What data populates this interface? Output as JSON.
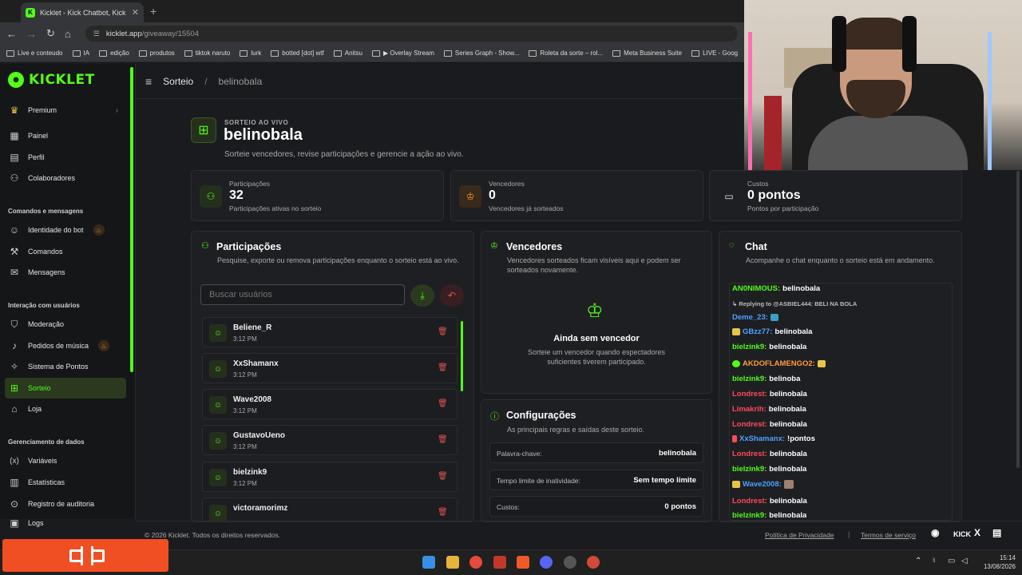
{
  "browser": {
    "tab_title": "Kicklet - Kick Chatbot, Kick Wi...",
    "url_host": "kicklet.app",
    "url_path": "/giveaway/15504",
    "bookmarks": [
      "Live e conteudo",
      "IA",
      "edição",
      "produtos",
      "tiktok naruto",
      "lurk",
      "botted [dot] wtf",
      "Anitsu",
      "▶ Overlay Stream",
      "Series Graph - Show...",
      "Roleta da sorte – rol...",
      "Meta Business Suite",
      "LIVE - Goog"
    ]
  },
  "brand": {
    "name": "KICKLET",
    "accent": "#53fc18"
  },
  "sidebar": {
    "premium": "Premium",
    "items_top": [
      "Painel",
      "Perfil",
      "Colaboradores"
    ],
    "section1": "Comandos e mensagens",
    "items_s1": [
      "Identidade do bot",
      "Comandos",
      "Mensagens"
    ],
    "section2": "Interação com usuários",
    "items_s2": [
      "Moderação",
      "Pedidos de música",
      "Sistema de Pontos",
      "Sorteio",
      "Loja"
    ],
    "section3": "Gerenciamento de dados",
    "items_s3": [
      "Variáveis",
      "Estatísticas",
      "Registro de auditoria",
      "Logs"
    ]
  },
  "header": {
    "crumb1": "Sorteio",
    "sep": "/",
    "crumb2": "belinobala"
  },
  "page": {
    "live_label": "SORTEIO AO VIVO",
    "title": "belinobala",
    "subtitle": "Sorteie vencedores, revise participações e gerencie a ação ao vivo."
  },
  "stats": [
    {
      "label": "Participações",
      "value": "32",
      "desc": "Participações ativas no sorteio"
    },
    {
      "label": "Vencedores",
      "value": "0",
      "desc": "Vencedores já sorteados"
    },
    {
      "label": "Custos",
      "value": "0 pontos",
      "desc": "Pontos por participação"
    }
  ],
  "participants_panel": {
    "title": "Participações",
    "desc": "Pesquise, exporte ou remova participações enquanto o sorteio está ao vivo.",
    "search_placeholder": "Buscar usuários",
    "entries": [
      {
        "name": "Beliene_R",
        "time": "3:12 PM"
      },
      {
        "name": "XxShamanx",
        "time": "3:12 PM"
      },
      {
        "name": "Wave2008",
        "time": "3:12 PM"
      },
      {
        "name": "GustavoUeno",
        "time": "3:12 PM"
      },
      {
        "name": "bielzink9",
        "time": "3:12 PM"
      },
      {
        "name": "victoramorimz",
        "time": ""
      }
    ]
  },
  "winners_panel": {
    "title": "Vencedores",
    "desc": "Vencedores sorteados ficam visíveis aqui e podem ser sorteados novamente.",
    "empty_title": "Ainda sem vencedor",
    "empty_desc": "Sorteie um vencedor quando espectadores suficientes tiverem participado."
  },
  "config_panel": {
    "title": "Configurações",
    "desc": "As principais regras e saídas deste sorteio.",
    "rows": [
      {
        "key": "Palavra-chave:",
        "value": "belinobala"
      },
      {
        "key": "Tempo limite de inatividade:",
        "value": "Sem tempo limite"
      },
      {
        "key": "Custos:",
        "value": "0 pontos"
      }
    ]
  },
  "chat_panel": {
    "title": "Chat",
    "desc": "Acompanhe o chat enquanto o sorteio está em andamento.",
    "messages": [
      {
        "user": "AN0NIMOUS:",
        "text": "belinobala",
        "color": "#53fc18"
      },
      {
        "user": "",
        "text": "↳ Replying to @ASBIEL444: BELI NA BOLA",
        "color": "#bbbbbb",
        "reply": true
      },
      {
        "user": "Deme_23:",
        "text": "",
        "color": "#4aa3ff"
      },
      {
        "user": "GBzz77:",
        "text": "belinobala",
        "color": "#4aa3ff"
      },
      {
        "user": "bielzink9:",
        "text": "belinobala",
        "color": "#53fc18"
      },
      {
        "user": "AKDOFLAMENGO2:",
        "text": "",
        "color": "#ff9a3c"
      },
      {
        "user": "bielzink9:",
        "text": "belinoba",
        "color": "#53fc18"
      },
      {
        "user": "Londrest:",
        "text": "belinobala",
        "color": "#ff4a5a"
      },
      {
        "user": "Limakrih:",
        "text": "belinobala",
        "color": "#ff4a5a"
      },
      {
        "user": "Londrest:",
        "text": "belinobala",
        "color": "#ff4a5a"
      },
      {
        "user": "XxShamanx:",
        "text": "!pontos",
        "color": "#4aa3ff"
      },
      {
        "user": "Londrest:",
        "text": "belinobala",
        "color": "#ff4a5a"
      },
      {
        "user": "bielzink9:",
        "text": "belinobala",
        "color": "#53fc18"
      },
      {
        "user": "Wave2008:",
        "text": "",
        "color": "#4aa3ff"
      },
      {
        "user": "Londrest:",
        "text": "belinobala",
        "color": "#ff4a5a"
      },
      {
        "user": "bielzink9:",
        "text": "belinobala",
        "color": "#53fc18"
      }
    ]
  },
  "footer": {
    "copyright": "© 2026 Kicklet. Todos os direitos reservados.",
    "privacy": "Política de Privacidade",
    "sep": "|",
    "terms": "Termos de serviço",
    "kick": "KICK",
    "x": "X"
  },
  "taskbar": {
    "time": "15:14",
    "date": "13/08/2026"
  }
}
